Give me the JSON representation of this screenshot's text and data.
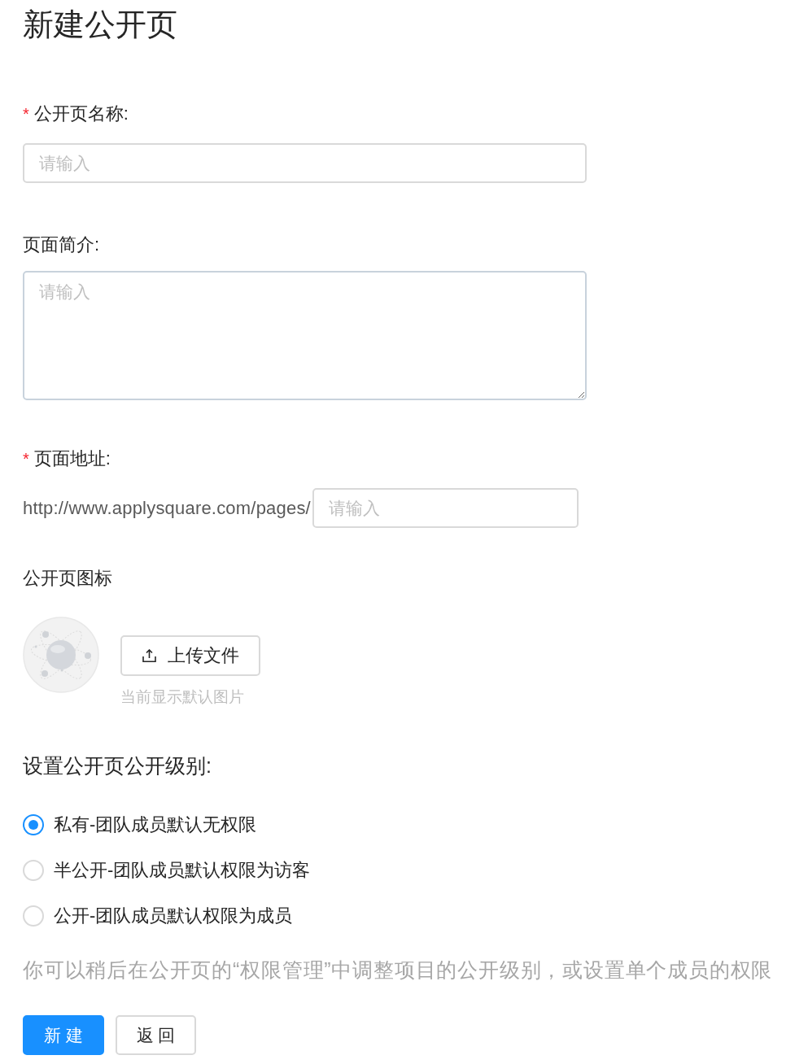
{
  "page": {
    "title": "新建公开页"
  },
  "fields": [
    {
      "kind": "input",
      "required_mark": "*",
      "label": "公开页名称:",
      "placeholder": "请输入"
    },
    {
      "kind": "textarea",
      "label": "页面简介:",
      "placeholder": "请输入"
    },
    {
      "kind": "url",
      "required_mark": "*",
      "label": "页面地址:",
      "prefix": "http://www.applysquare.com/pages/",
      "placeholder": "请输入"
    }
  ],
  "icon_section": {
    "label": "公开页图标",
    "upload_button": "上传文件",
    "hint": "当前显示默认图片"
  },
  "visibility": {
    "label": "设置公开页公开级别:",
    "options": [
      {
        "label": "私有-团队成员默认无权限",
        "selected": true
      },
      {
        "label": "半公开-团队成员默认权限为访客",
        "selected": false
      },
      {
        "label": "公开-团队成员默认权限为成员",
        "selected": false
      }
    ],
    "note": "你可以稍后在公开页的“权限管理”中调整项目的公开级别，或设置单个成员的权限"
  },
  "buttons": [
    {
      "kind": "primary",
      "label": "新 建"
    },
    {
      "kind": "default",
      "label": "返 回"
    }
  ]
}
